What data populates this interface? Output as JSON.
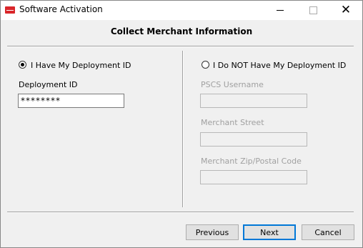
{
  "window": {
    "title": "Software Activation"
  },
  "header": {
    "title": "Collect Merchant Information"
  },
  "left": {
    "radio_label": "I Have My Deployment ID",
    "deployment_id_label": "Deployment ID",
    "deployment_id_value": "********"
  },
  "right": {
    "radio_label": "I Do NOT Have My Deployment ID",
    "pscs_username_label": "PSCS Username",
    "pscs_username_value": "",
    "merchant_street_label": "Merchant Street",
    "merchant_street_value": "",
    "merchant_zip_label": "Merchant Zip/Postal Code",
    "merchant_zip_value": ""
  },
  "buttons": {
    "previous": "Previous",
    "next": "Next",
    "cancel": "Cancel"
  }
}
